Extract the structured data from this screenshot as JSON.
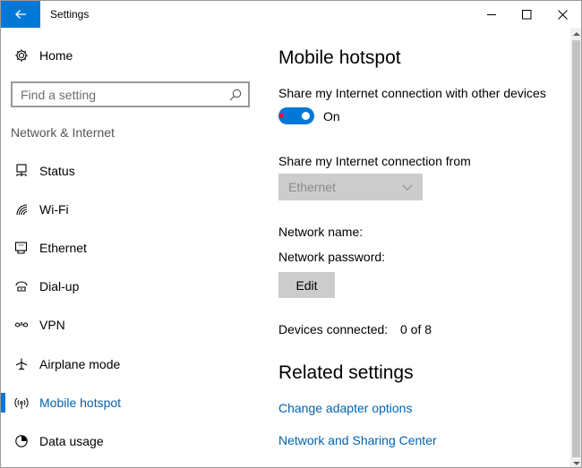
{
  "window": {
    "title": "Settings",
    "accent": "#0078d7"
  },
  "sidebar": {
    "home_label": "Home",
    "search_placeholder": "Find a setting",
    "section_title": "Network & Internet",
    "items": [
      {
        "label": "Status",
        "icon": "status-icon"
      },
      {
        "label": "Wi-Fi",
        "icon": "wifi-icon"
      },
      {
        "label": "Ethernet",
        "icon": "ethernet-icon"
      },
      {
        "label": "Dial-up",
        "icon": "dialup-icon"
      },
      {
        "label": "VPN",
        "icon": "vpn-icon"
      },
      {
        "label": "Airplane mode",
        "icon": "airplane-icon"
      },
      {
        "label": "Mobile hotspot",
        "icon": "hotspot-icon",
        "active": true
      },
      {
        "label": "Data usage",
        "icon": "data-usage-icon"
      }
    ]
  },
  "main": {
    "title": "Mobile hotspot",
    "share_label": "Share my Internet connection with other devices",
    "toggle_state": "On",
    "share_from_label": "Share my Internet connection from",
    "share_from_value": "Ethernet",
    "network_name_label": "Network name:",
    "network_password_label": "Network password:",
    "edit_label": "Edit",
    "devices_label": "Devices connected:",
    "devices_value": "0 of 8",
    "related_title": "Related settings",
    "links": [
      "Change adapter options",
      "Network and Sharing Center"
    ]
  }
}
